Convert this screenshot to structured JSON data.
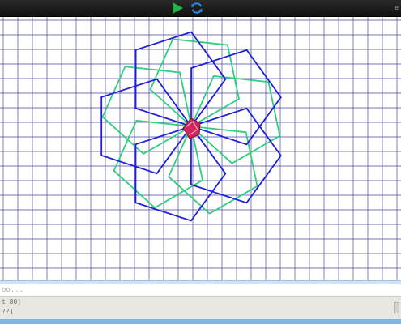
{
  "toolbar": {
    "run_icon": "play-icon",
    "reset_icon": "refresh-icon",
    "run_color": "#22b14c",
    "reset_color": "#2b8be6",
    "right_fragment": "e"
  },
  "canvas": {
    "background": "#ffffff",
    "grid_color": "#4a4a9a",
    "pattern": {
      "blue_color": "#1f1fd6",
      "green_color": "#2ecf7c",
      "center_turtle_color": "#d1265f"
    }
  },
  "command_line": {
    "text": "oo..."
  },
  "editor": {
    "lines": [
      "t 80]",
      "??]"
    ]
  },
  "colors": {
    "divider": "#cfe3f4",
    "editor_bg": "#e8e6e1",
    "status_bar": "#7fb6e4"
  }
}
